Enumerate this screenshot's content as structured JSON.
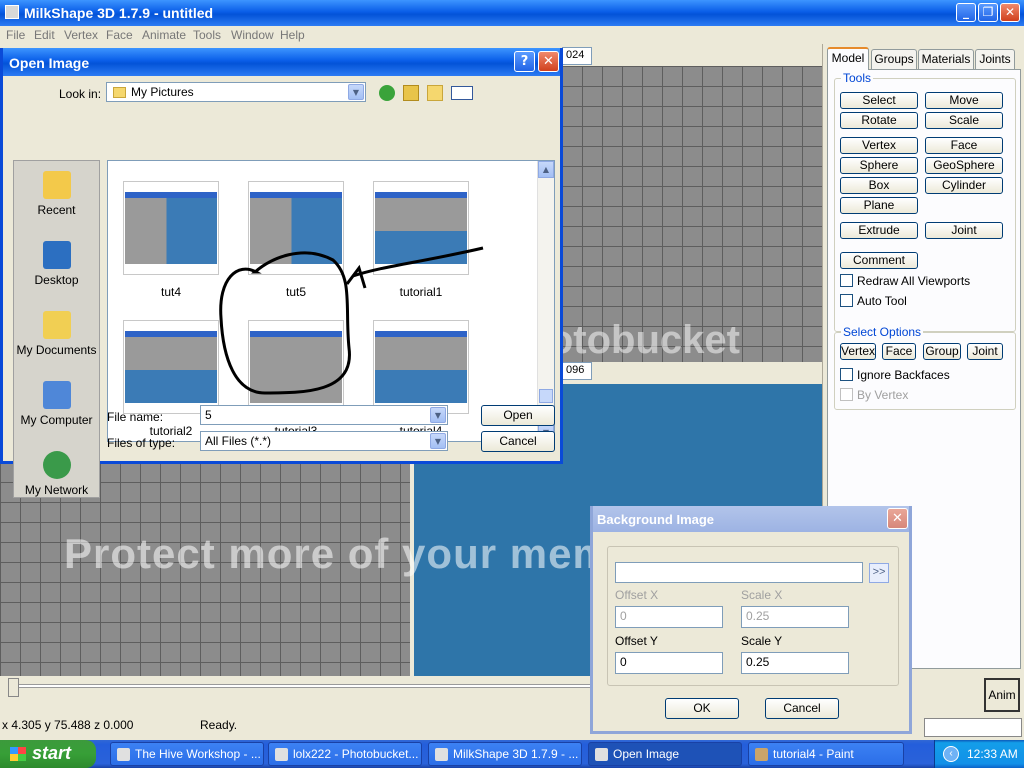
{
  "window": {
    "title": "MilkShape 3D 1.7.9 - untitled",
    "minimize": "_",
    "restore": "❐",
    "close": "✕"
  },
  "menu": [
    "File",
    "Edit",
    "Vertex",
    "Face",
    "Animate",
    "Tools",
    "Window",
    "Help"
  ],
  "viewport_fields": {
    "top": "024",
    "mid": "096"
  },
  "panel": {
    "tabs": [
      "Model",
      "Groups",
      "Materials",
      "Joints"
    ],
    "tools_title": "Tools",
    "tools": [
      "Select",
      "Move",
      "Rotate",
      "Scale",
      "Vertex",
      "Face",
      "Sphere",
      "GeoSphere",
      "Box",
      "Cylinder",
      "Plane",
      "Extrude",
      "Joint",
      "Comment"
    ],
    "checks": [
      "Redraw All Viewports",
      "Auto Tool"
    ],
    "select_options_title": "Select Options",
    "select_buttons": [
      "Vertex",
      "Face",
      "Group",
      "Joint"
    ],
    "select_checks": [
      "Ignore Backfaces",
      "By Vertex"
    ]
  },
  "anim_button": "Anim",
  "status": {
    "coords": "x 4.305 y 75.488 z 0.000",
    "text": "Ready."
  },
  "open_dialog": {
    "title": "Open Image",
    "help": "?",
    "close": "✕",
    "look_in_label": "Look in:",
    "look_in_value": "My Pictures",
    "places": [
      "Recent",
      "Desktop",
      "My Documents",
      "My Computer",
      "My Network"
    ],
    "files": [
      "tut4",
      "tut5",
      "tutorial1",
      "tutorial2",
      "tutorial3",
      "tutorial4"
    ],
    "file_name_label": "File name:",
    "file_name_value": "5",
    "file_type_label": "Files of type:",
    "file_type_value": "All Files (*.*)",
    "open_button": "Open",
    "cancel_button": "Cancel"
  },
  "bg_dialog": {
    "title": "Background Image",
    "close": "✕",
    "browse": ">>",
    "offset_x_label": "Offset X",
    "offset_x_value": "0",
    "scale_x_label": "Scale X",
    "scale_x_value": "0.25",
    "offset_y_label": "Offset Y",
    "offset_y_value": "0",
    "scale_y_label": "Scale Y",
    "scale_y_value": "0.25",
    "ok_button": "OK",
    "cancel_button": "Cancel"
  },
  "watermark": "Protect more of your memories for less!",
  "watermark_brand": "photobucket",
  "taskbar": {
    "start": "start",
    "tasks": [
      "The Hive Workshop - ...",
      "lolx222 - Photobucket...",
      "MilkShape 3D 1.7.9 - ...",
      "Open Image",
      "tutorial4 - Paint"
    ],
    "clock": "12:33 AM"
  },
  "colors": {
    "xp_blue": "#0a5ee8",
    "viewport_grey": "#8c8c8c",
    "viewport_blue": "#2e75a9",
    "start_green": "#379f37"
  }
}
